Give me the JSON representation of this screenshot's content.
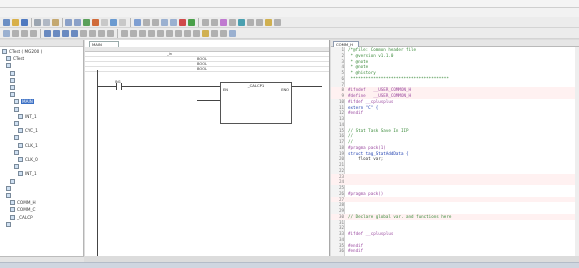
{
  "window": {
    "title": ""
  },
  "menubar": {
    "items": []
  },
  "project_tree": {
    "header": "",
    "items": [
      {
        "label": "CTest ( MG200 )"
      },
      {
        "label": "CTest"
      },
      {
        "label": ""
      },
      {
        "label": ""
      },
      {
        "label": ""
      },
      {
        "label": ""
      },
      {
        "label": ""
      },
      {
        "label": "MAIN",
        "selected": true
      },
      {
        "label": ""
      },
      {
        "label": "INT_1"
      },
      {
        "label": ""
      },
      {
        "label": "CYC_1"
      },
      {
        "label": ""
      },
      {
        "label": "CLK_1"
      },
      {
        "label": ""
      },
      {
        "label": "CLK_0"
      },
      {
        "label": ""
      },
      {
        "label": "INT_1"
      },
      {
        "label": ""
      },
      {
        "label": ""
      },
      {
        "label": ""
      },
      {
        "label": "COMM_H"
      },
      {
        "label": "COMM_C"
      },
      {
        "label": "_CALCP"
      },
      {
        "label": ""
      }
    ],
    "tabs": []
  },
  "ld_editor": {
    "tab_label": "MAIN",
    "columns": [
      "",
      "",
      "",
      "",
      ""
    ],
    "rows": [
      {
        "col2": "",
        "col3": "_in",
        "col4": ""
      },
      {
        "col2": "",
        "col3": "",
        "col4": "BOOL"
      },
      {
        "col2": "",
        "col3": "",
        "col4": "BOOL"
      },
      {
        "col2": "",
        "col3": "",
        "col4": "BOOL"
      }
    ],
    "contact_label": "IN1",
    "block_title": "_CALCP1",
    "block_inputs": [
      "EN",
      "ENO"
    ],
    "row_labels": [
      "",
      "",
      "",
      "",
      "",
      ""
    ]
  },
  "code_editor": {
    "tab_label": "COMM_H",
    "lines": [
      {
        "num": "1",
        "text": "/*@file: Common header file",
        "cls": "c-comment"
      },
      {
        "num": "2",
        "text": " * @version v1.1.0",
        "cls": "c-comment"
      },
      {
        "num": "3",
        "text": " * @note",
        "cls": "c-comment"
      },
      {
        "num": "4",
        "text": " * @note",
        "cls": "c-comment"
      },
      {
        "num": "5",
        "text": " * @history",
        "cls": "c-comment"
      },
      {
        "num": "6",
        "text": " ***************************************",
        "cls": "c-comment"
      },
      {
        "num": "7",
        "text": "",
        "cls": "c-txt"
      },
      {
        "num": "8",
        "text": "#ifndef   __USER_COMMON_H",
        "cls": "c-pp",
        "hl": true
      },
      {
        "num": "9",
        "text": "#define   __USER_COMMON_H",
        "cls": "c-pp",
        "hl": true
      },
      {
        "num": "10",
        "text": "#ifdef __cplusplus",
        "cls": "c-pp"
      },
      {
        "num": "11",
        "text": "extern \"C\" {",
        "cls": "c-kw"
      },
      {
        "num": "12",
        "text": "#endif",
        "cls": "c-pp"
      },
      {
        "num": "13",
        "text": "",
        "cls": "c-txt"
      },
      {
        "num": "14",
        "text": "",
        "cls": "c-txt"
      },
      {
        "num": "15",
        "text": "// Stat Task Save In IIP",
        "cls": "c-comment"
      },
      {
        "num": "16",
        "text": "// ",
        "cls": "c-comment"
      },
      {
        "num": "17",
        "text": "// ",
        "cls": "c-comment"
      },
      {
        "num": "18",
        "text": "#pragma pack(1)",
        "cls": "c-pp"
      },
      {
        "num": "19",
        "text": "struct tag_StatAddData {",
        "cls": "c-kw"
      },
      {
        "num": "20",
        "text": "    float var;",
        "cls": "c-txt"
      },
      {
        "num": "21",
        "text": "",
        "cls": "c-txt"
      },
      {
        "num": "22",
        "text": "",
        "cls": "c-txt"
      },
      {
        "num": "23",
        "text": "",
        "cls": "c-red",
        "hl": true
      },
      {
        "num": "24",
        "text": "",
        "cls": "c-red",
        "hl": true
      },
      {
        "num": "25",
        "text": "",
        "cls": "c-txt"
      },
      {
        "num": "26",
        "text": "#pragma pack()",
        "cls": "c-pp"
      },
      {
        "num": "27",
        "text": "",
        "cls": "c-txt",
        "hl": true
      },
      {
        "num": "28",
        "text": "",
        "cls": "c-txt"
      },
      {
        "num": "29",
        "text": "",
        "cls": "c-txt"
      },
      {
        "num": "30",
        "text": "// Declare global var. and functions here",
        "cls": "c-comment",
        "hl": true
      },
      {
        "num": "31",
        "text": "",
        "cls": "c-txt"
      },
      {
        "num": "32",
        "text": "",
        "cls": "c-txt"
      },
      {
        "num": "33",
        "text": "#ifdef __cplusplus",
        "cls": "c-pp"
      },
      {
        "num": "34",
        "text": "",
        "cls": "c-txt"
      },
      {
        "num": "35",
        "text": "#endif",
        "cls": "c-pp"
      },
      {
        "num": "36",
        "text": "#endif",
        "cls": "c-pp"
      }
    ],
    "trailing_comments": {
      "l20": "",
      "l22": "",
      "l23": ""
    }
  },
  "statusbar": {
    "left": ""
  },
  "icons": [
    "new-icon",
    "open-icon",
    "save-icon",
    "cut-icon",
    "copy-icon",
    "paste-icon",
    "undo-icon",
    "redo-icon",
    "compile-icon",
    "download-icon",
    "run-icon",
    "stop-icon",
    "monitor-icon"
  ]
}
